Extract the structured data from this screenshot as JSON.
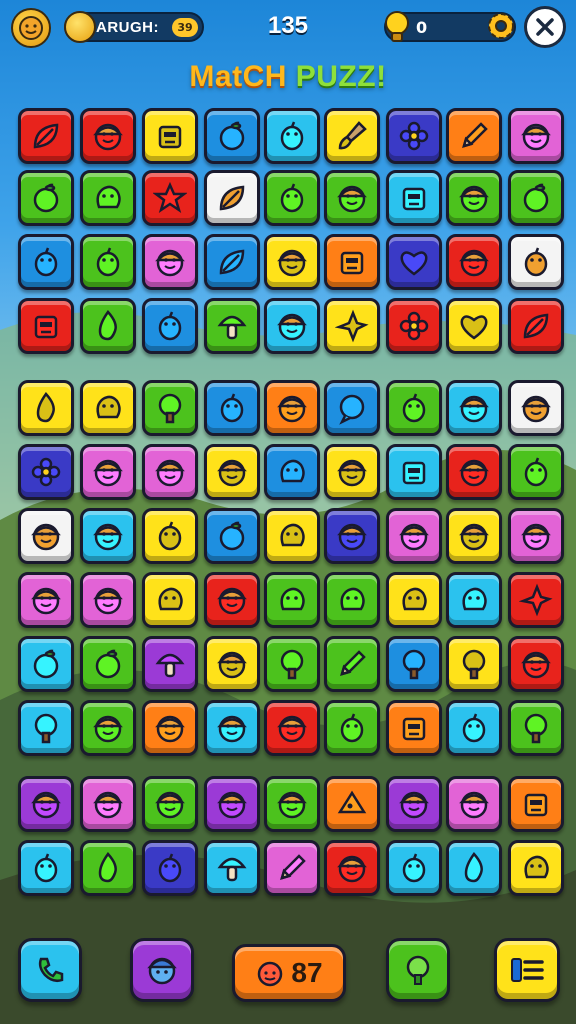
{
  "header": {
    "player_name": "ARUGH:",
    "player_level": "39",
    "score": "135",
    "hint_count": "0"
  },
  "title": {
    "part1": "MatCH ",
    "part2": "PUZZ!"
  },
  "colors": {
    "red": "#e8231c",
    "purple": "#9b3ad6",
    "yellow": "#ffe21a",
    "blue": "#1e8fe0",
    "cyan": "#2bc2ee",
    "green": "#4cc21d",
    "orange": "#ff7f16",
    "pink": "#e263d6",
    "white": "#f4f4f4",
    "navy": "#3a3ac6",
    "lime": "#9ee21f"
  },
  "board": {
    "rows": [
      [
        "red",
        "red",
        "yellow",
        "blue",
        "cyan",
        "yellow",
        "navy",
        "orange",
        "pink"
      ],
      [
        "green",
        "green",
        "red",
        "white",
        "green",
        "green",
        "cyan",
        "green",
        "green"
      ],
      [
        "blue",
        "green",
        "pink",
        "blue",
        "yellow",
        "orange",
        "navy",
        "red",
        "white"
      ],
      [
        "red",
        "green",
        "blue",
        "green",
        "cyan",
        "yellow",
        "red",
        "yellow",
        "red"
      ],
      [
        "yellow",
        "yellow",
        "green",
        "blue",
        "orange",
        "blue",
        "green",
        "cyan",
        "white"
      ],
      [
        "navy",
        "pink",
        "pink",
        "yellow",
        "blue",
        "yellow",
        "cyan",
        "red",
        "green"
      ],
      [
        "white",
        "cyan",
        "yellow",
        "blue",
        "yellow",
        "navy",
        "pink",
        "yellow",
        "pink"
      ],
      [
        "pink",
        "pink",
        "yellow",
        "red",
        "green",
        "green",
        "yellow",
        "cyan",
        "red"
      ],
      [
        "cyan",
        "green",
        "purple",
        "yellow",
        "green",
        "green",
        "blue",
        "yellow",
        "red"
      ],
      [
        "cyan",
        "green",
        "orange",
        "cyan",
        "red",
        "green",
        "orange",
        "cyan",
        "green"
      ],
      [
        "purple",
        "pink",
        "green",
        "purple",
        "green",
        "orange",
        "purple",
        "pink",
        "orange"
      ],
      [
        "cyan",
        "green",
        "navy",
        "cyan",
        "pink",
        "red",
        "cyan",
        "cyan",
        "yellow"
      ]
    ],
    "icons": [
      [
        "leaf",
        "face",
        "robot",
        "apple",
        "fruit",
        "brush",
        "flower",
        "pencil",
        "face"
      ],
      [
        "apple",
        "blob",
        "star",
        "leaf",
        "fruit",
        "face",
        "robot",
        "face",
        "apple"
      ],
      [
        "fruit",
        "fruit",
        "face",
        "leaf",
        "face",
        "robot",
        "heart",
        "face",
        "fruit"
      ],
      [
        "robot",
        "flame",
        "fruit",
        "mushroom",
        "face",
        "bird",
        "flower",
        "heart",
        "leaf"
      ],
      [
        "flame",
        "blob",
        "tree",
        "fruit",
        "face",
        "bubble",
        "fruit",
        "face",
        "face"
      ],
      [
        "flower",
        "face",
        "face",
        "face",
        "blob",
        "face",
        "robot",
        "face",
        "fruit"
      ],
      [
        "face",
        "face",
        "fruit",
        "apple",
        "blob",
        "face",
        "face",
        "face",
        "face"
      ],
      [
        "face",
        "face",
        "blob",
        "face",
        "blob",
        "blob",
        "blob",
        "blob",
        "bird"
      ],
      [
        "apple",
        "apple",
        "mushroom",
        "face",
        "tree",
        "pencil",
        "tree",
        "tree",
        "face"
      ],
      [
        "tree",
        "face",
        "face",
        "face",
        "face",
        "fruit",
        "robot",
        "fruit",
        "tree"
      ],
      [
        "face",
        "face",
        "face",
        "face",
        "face",
        "cheese",
        "face",
        "face",
        "robot"
      ],
      [
        "fruit",
        "flame",
        "fruit",
        "mushroom",
        "pencil",
        "face",
        "fruit",
        "flame",
        "blob"
      ]
    ]
  },
  "bottom": {
    "moves": "87",
    "buttons": [
      {
        "color": "cyan",
        "icon": "phone-icon"
      },
      {
        "color": "purple",
        "icon": "character-icon"
      },
      {
        "color": "orange",
        "icon": "moves-icon"
      },
      {
        "color": "green",
        "icon": "tree-icon"
      },
      {
        "color": "yellow",
        "icon": "menu-icon"
      }
    ]
  }
}
